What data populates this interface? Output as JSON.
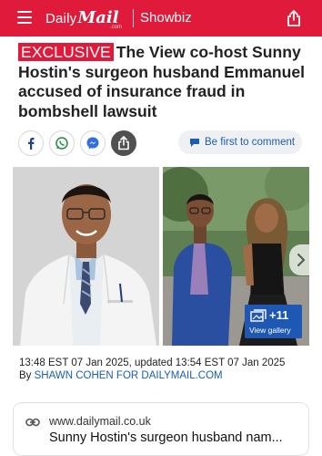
{
  "header": {
    "brand_daily": "Daily",
    "brand_mail": "Mail",
    "brand_sub": ".com",
    "section": "Showbiz",
    "colors": {
      "brand_red": "#e01a3a"
    }
  },
  "article": {
    "badge": "EXCLUSIVE",
    "headline": "The View co-host Sunny Hostin's surgeon husband Emmanuel accused of insurance fraud in bombshell lawsuit",
    "comment_button": "Be first to comment",
    "gallery": {
      "count": "+11",
      "label": "View gallery"
    },
    "timestamp": "13:48 EST 07 Jan 2025, updated 13:54 EST 07 Jan 2025",
    "byline_prefix": "By",
    "author": "SHAWN COHEN FOR DAILYMAIL.COM"
  },
  "link_card": {
    "domain": "www.dailymail.co.uk",
    "title": "Sunny Hostin's surgeon husband nam..."
  },
  "icons": [
    "menu-icon",
    "share-icon",
    "facebook-icon",
    "whatsapp-icon",
    "messenger-icon",
    "comment-icon",
    "gallery-icon",
    "chevron-right-icon",
    "link-icon"
  ]
}
